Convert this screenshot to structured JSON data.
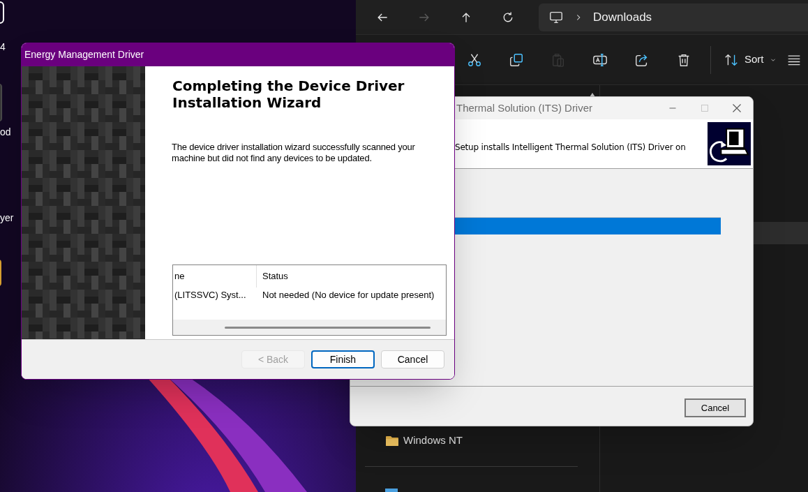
{
  "desktop": {
    "icon_labels": [
      "4",
      "od",
      "yer"
    ]
  },
  "explorer": {
    "nav_buttons": [
      {
        "kind": "back",
        "disabled": false
      },
      {
        "kind": "forward",
        "disabled": true
      },
      {
        "kind": "up",
        "disabled": false
      },
      {
        "kind": "refresh",
        "disabled": false
      }
    ],
    "address": {
      "location": "Downloads"
    },
    "commands": [
      {
        "kind": "cut",
        "disabled": false
      },
      {
        "kind": "copy",
        "disabled": false
      },
      {
        "kind": "paste",
        "disabled": true
      },
      {
        "kind": "rename",
        "disabled": false
      },
      {
        "kind": "share",
        "disabled": false
      },
      {
        "kind": "delete",
        "disabled": false
      }
    ],
    "sort": {
      "label": "Sort"
    },
    "nav_items": [
      {
        "label": "Windows NT"
      }
    ]
  },
  "its_window": {
    "title": "Thermal Solution (ITS) Driver",
    "header_text": "Setup installs Intelligent Thermal Solution (ITS) Driver on",
    "progress": {
      "level": 1
    },
    "buttons": [
      {
        "label": "Cancel"
      }
    ]
  },
  "wizard": {
    "title": "Energy Management Driver",
    "heading": "Completing the Device Driver Installation Wizard",
    "body": "The device driver installation wizard successfully scanned your machine but did not find any devices to be updated.",
    "table": {
      "columns": [
        "ne",
        "Status"
      ],
      "rows": [
        [
          "(LITSSVC) Syst...",
          "Not needed (No device for update present)"
        ]
      ]
    },
    "buttons": [
      {
        "label": "< Back",
        "disabled": true,
        "default": false
      },
      {
        "label": "Finish",
        "disabled": false,
        "default": true
      },
      {
        "label": "Cancel",
        "disabled": false,
        "default": false
      }
    ]
  }
}
